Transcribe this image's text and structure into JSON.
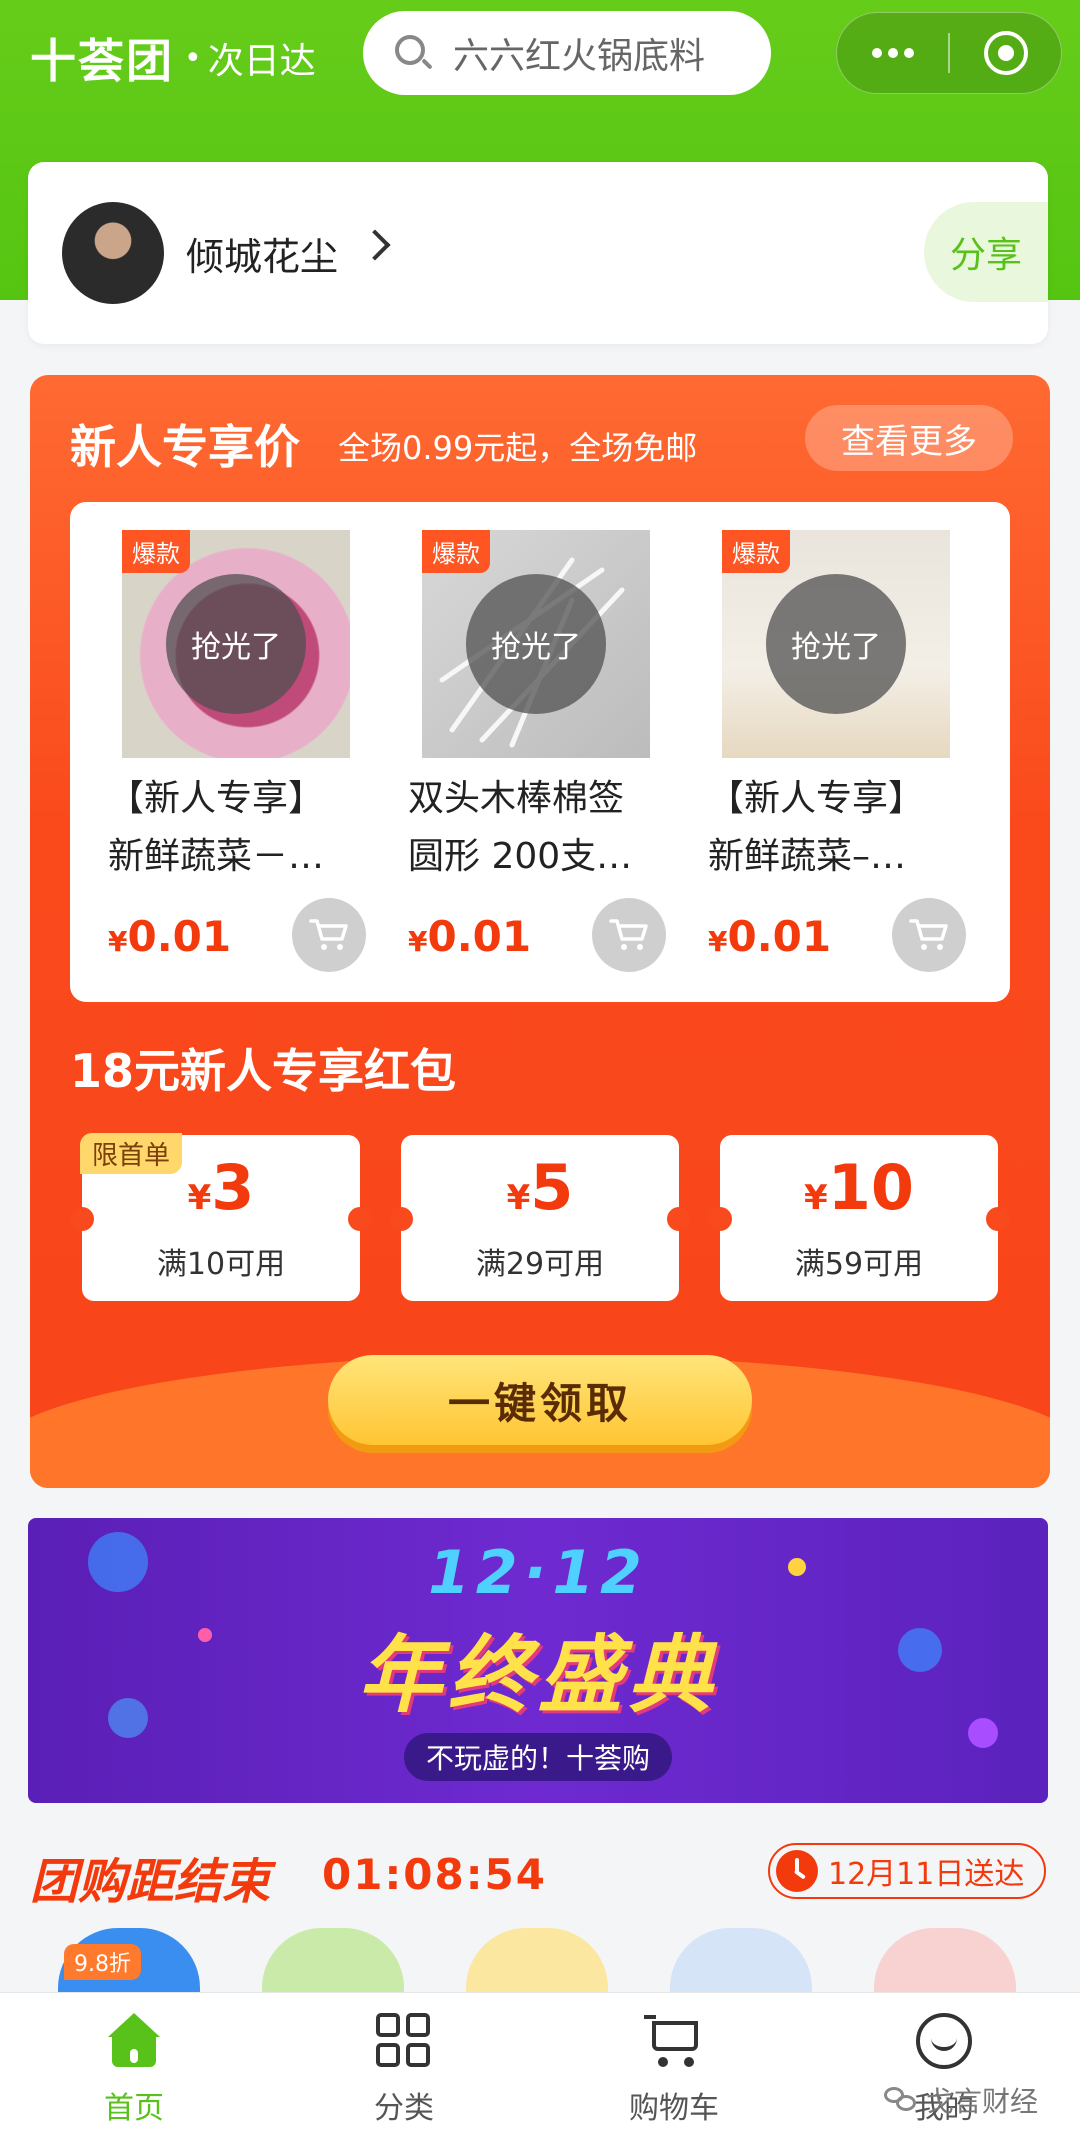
{
  "header": {
    "brand_name": "十荟团",
    "brand_sub": "次日达",
    "search_placeholder": "六六红火锅底料",
    "accent_color": "#5fc817"
  },
  "user": {
    "name": "倾城花尘",
    "share_label": "分享"
  },
  "promo": {
    "title": "新人专享价",
    "subtitle": "全场0.99元起，全场免邮",
    "see_more": "查看更多",
    "products": [
      {
        "badge": "爆款",
        "status": "抢光了",
        "name_line1": "【新人专享】",
        "name_line2": "新鲜蔬菜－…",
        "price_symbol": "¥",
        "price": "0.01",
        "image": "onion"
      },
      {
        "badge": "爆款",
        "status": "抢光了",
        "name_line1": "双头木棒棉签",
        "name_line2": "圆形 200支…",
        "price_symbol": "¥",
        "price": "0.01",
        "image": "cotton-swab"
      },
      {
        "badge": "爆款",
        "status": "抢光了",
        "name_line1": "【新人专享】",
        "name_line2": "新鲜蔬菜–…",
        "price_symbol": "¥",
        "price": "0.01",
        "image": "radish"
      }
    ],
    "coupon_title": "18元新人专享红包",
    "coupons": [
      {
        "tag": "限首单",
        "symbol": "¥",
        "amount": "3",
        "condition": "满10可用"
      },
      {
        "tag": "",
        "symbol": "¥",
        "amount": "5",
        "condition": "满29可用"
      },
      {
        "tag": "",
        "symbol": "¥",
        "amount": "10",
        "condition": "满59可用"
      }
    ],
    "claim_label": "一键领取",
    "promo_color": "#f84a1c"
  },
  "banner": {
    "top": "12·12",
    "title": "年终盛典",
    "tag": "不玩虚的！十荟购"
  },
  "group_buy": {
    "title": "团购距结束",
    "countdown": "01:08:54",
    "delivery": "12月11日送达",
    "discount_badge": "9.8折"
  },
  "tabbar": {
    "tabs": [
      {
        "label": "首页",
        "icon": "home-icon",
        "active": true
      },
      {
        "label": "分类",
        "icon": "grid-icon",
        "active": false
      },
      {
        "label": "购物车",
        "icon": "cart-icon",
        "active": false
      },
      {
        "label": "我的",
        "icon": "smile-icon",
        "active": false
      }
    ]
  },
  "watermark": "戈言财经"
}
